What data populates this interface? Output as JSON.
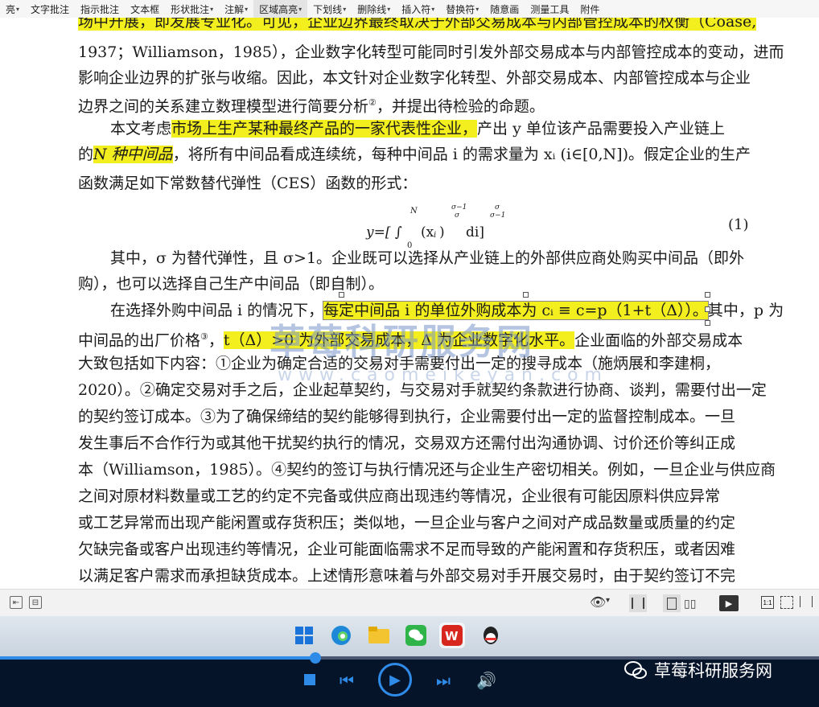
{
  "toolbar": {
    "items": [
      {
        "label": "亮",
        "arrow": true
      },
      {
        "label": "文字批注",
        "arrow": false
      },
      {
        "label": "指示批注",
        "arrow": false
      },
      {
        "label": "文本框",
        "arrow": false
      },
      {
        "label": "形状批注",
        "arrow": true
      },
      {
        "label": "注解",
        "arrow": true
      },
      {
        "label": "区域高亮",
        "arrow": true
      },
      {
        "label": "下划线",
        "arrow": true
      },
      {
        "label": "删除线",
        "arrow": true
      },
      {
        "label": "插入符",
        "arrow": true
      },
      {
        "label": "替换符",
        "arrow": true
      },
      {
        "label": "随意画",
        "arrow": false
      },
      {
        "label": "测量工具",
        "arrow": false
      },
      {
        "label": "附件",
        "arrow": false
      }
    ],
    "arrow_glyph": "▾"
  },
  "document": {
    "l1a": "场中开展，即发展专业化。可见，企业边界最终取决于外部交易成本与内部管控成本的权衡（Coase,",
    "l2": "1937；Williamson，1985），企业数字化转型可能同时引发外部交易成本与内部管控成本的变动，进而",
    "l3": "影响企业边界的扩张与收缩。因此，本文针对企业数字化转型、外部交易成本、内部管控成本与企业",
    "l4a": "边界之间的关系建立数理模型进行简要分析",
    "l4sup": "②",
    "l4b": "，并提出待检验的命题。",
    "l5a": "本文考虑",
    "l5hl": "市场上生产某种最终产品的一家代表性企业，",
    "l5b": "产出 y 单位该产品需要投入产业链上",
    "l6a": "的",
    "l6hl": "N 种中间品",
    "l6b": "，将所有中间品看成连续统，每种中间品 i 的需求量为 xᵢ (i∈[0,N])。假定企业的生产",
    "l7": "函数满足如下常数替代弹性（CES）函数的形式：",
    "formula": "y=[ ∫₀ᴺ (xᵢ)^((σ−1)/σ) di ]^(σ/(σ−1))",
    "formula_main": "y=[ ∫",
    "formula_sub": "0",
    "formula_sup": "N",
    "formula_mid": "(x",
    "formula_i": "i",
    "formula_close": ")",
    "formula_exp1": "σ−1",
    "formula_exp1d": "σ",
    "formula_di": "di]",
    "formula_exp2": "σ",
    "formula_exp2d": "σ−1",
    "eqno": "(1)",
    "l8": "其中，σ 为替代弹性，且 σ>1。企业既可以选择从产业链上的外部供应商处购买中间品（即外",
    "l9": "购），也可以选择自己生产中间品（即自制）。",
    "l10a": "在选择外购中间品 i 的情况下，",
    "l10hl": "每定中间品 i 的单位外购成本为 cᵢ ≡ c=p（1+t（Δ））。",
    "l10b": "其中，p 为",
    "l11a": "中间品的出厂价格",
    "l11sup": "③",
    "l11b": "，",
    "l11hl": "t（Δ）>0 为外部交易成本，Δ 为企业数字化水平。",
    "l11c": "企业面临的外部交易成本",
    "l12": "大致包括如下内容：①企业为确定合适的交易对手需要付出一定的搜寻成本（施炳展和李建桐，",
    "l13": "2020）。②确定交易对手之后，企业起草契约，与交易对手就契约条款进行协商、谈判，需要付出一定",
    "l14": "的契约签订成本。③为了确保缔结的契约能够得到执行，企业需要付出一定的监督控制成本。一旦",
    "l15": "发生事后不合作行为或其他干扰契约执行的情况，交易双方还需付出沟通协调、讨价还价等纠正成",
    "l16": "本（Williamson，1985）。④契约的签订与执行情况还与企业生产密切相关。例如，一旦企业与供应商",
    "l17": "之间对原材料数量或工艺的约定不完备或供应商出现违约等情况，企业很有可能因原料供应异常",
    "l18": "或工艺异常而出现产能闲置或存货积压；类似地，一旦企业与客户之间对产成品数量或质量的约定",
    "l19": "欠缺完备或客户出现违约等情况，企业可能面临需求不足而导致的产能闲置和存货积压，或者因难",
    "l20": "以满足客户需求而承担缺货成本。上述情形意味着与外部交易对手开展交易时，由于契约签订不完"
  },
  "watermark": {
    "main": "草莓科研服务网",
    "sub": "www.caomeikeyan.com"
  },
  "highlight_color": "#f3ee1e",
  "player": {
    "progress": 0.385,
    "brand": "草莓科研服务网"
  }
}
